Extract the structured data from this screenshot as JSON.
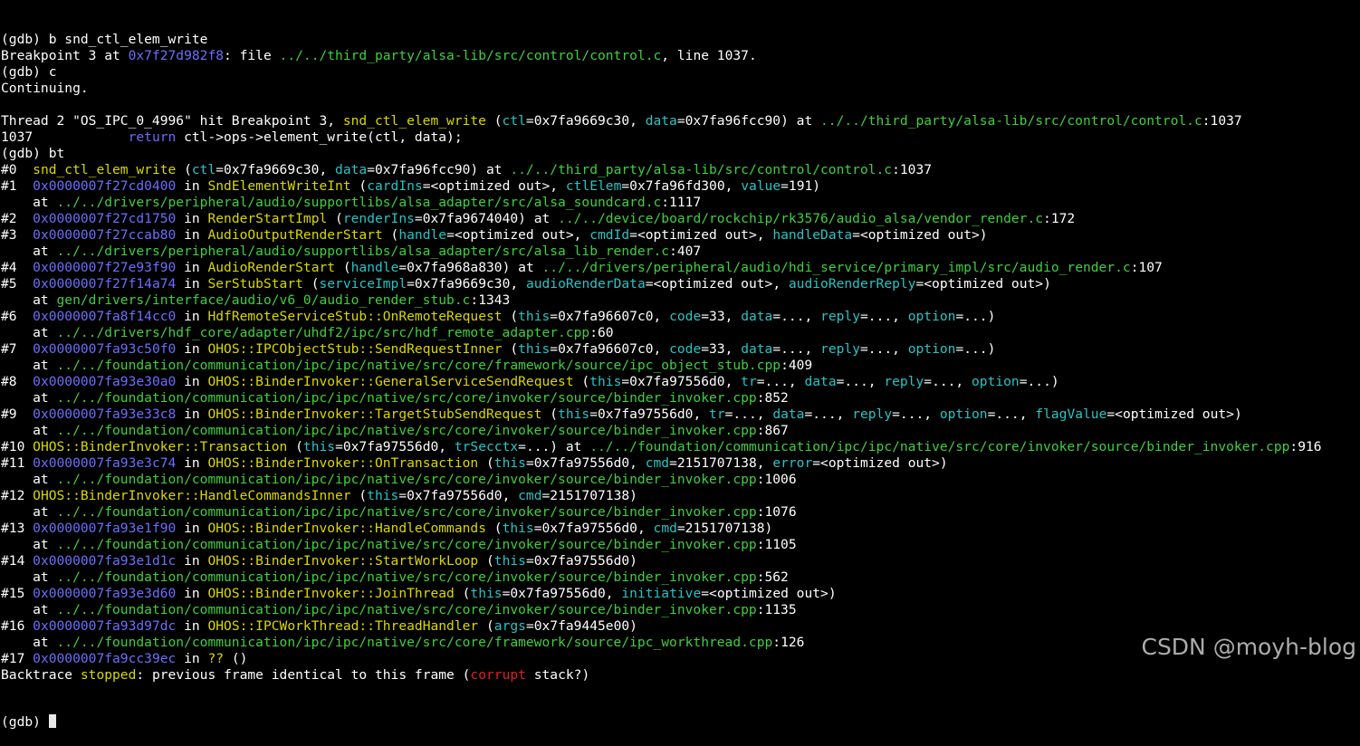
{
  "terminal": {
    "lines": [
      [
        [
          "default",
          "(gdb) b snd_ctl_elem_write"
        ]
      ],
      [
        [
          "default",
          "Breakpoint 3 at "
        ],
        [
          "addr",
          "0x7f27d982f8"
        ],
        [
          "default",
          ": file "
        ],
        [
          "path",
          "../../third_party/alsa-lib/src/control/control.c"
        ],
        [
          "default",
          ", line 1037."
        ]
      ],
      [
        [
          "default",
          "(gdb) c"
        ]
      ],
      [
        [
          "default",
          "Continuing."
        ]
      ],
      [
        [
          "default",
          ""
        ]
      ],
      [
        [
          "default",
          "Thread 2 \"OS_IPC_0_4996\" hit Breakpoint 3, "
        ],
        [
          "func",
          "snd_ctl_elem_write"
        ],
        [
          "default",
          " ("
        ],
        [
          "arg",
          "ctl"
        ],
        [
          "default",
          "=0x7fa9669c30, "
        ],
        [
          "arg",
          "data"
        ],
        [
          "default",
          "=0x7fa96fcc90) at "
        ],
        [
          "path",
          "../../third_party/alsa-lib/src/control/control.c"
        ],
        [
          "default",
          ":1037"
        ]
      ],
      [
        [
          "default",
          "1037            "
        ],
        [
          "kw",
          "return"
        ],
        [
          "default",
          " ctl->ops->element_write(ctl, data);"
        ]
      ],
      [
        [
          "default",
          "(gdb) bt"
        ]
      ],
      [
        [
          "default",
          "#0  "
        ],
        [
          "func",
          "snd_ctl_elem_write"
        ],
        [
          "default",
          " ("
        ],
        [
          "arg",
          "ctl"
        ],
        [
          "default",
          "=0x7fa9669c30, "
        ],
        [
          "arg",
          "data"
        ],
        [
          "default",
          "=0x7fa96fcc90) at "
        ],
        [
          "path",
          "../../third_party/alsa-lib/src/control/control.c"
        ],
        [
          "default",
          ":1037"
        ]
      ],
      [
        [
          "default",
          "#1  "
        ],
        [
          "addr",
          "0x0000007f27cd0400"
        ],
        [
          "default",
          " in "
        ],
        [
          "func",
          "SndElementWriteInt"
        ],
        [
          "default",
          " ("
        ],
        [
          "arg",
          "cardIns"
        ],
        [
          "default",
          "=<optimized out>, "
        ],
        [
          "arg",
          "ctlElem"
        ],
        [
          "default",
          "=0x7fa96fd300, "
        ],
        [
          "arg",
          "value"
        ],
        [
          "default",
          "=191)"
        ]
      ],
      [
        [
          "default",
          "    at "
        ],
        [
          "path",
          "../../drivers/peripheral/audio/supportlibs/alsa_adapter/src/alsa_soundcard.c"
        ],
        [
          "default",
          ":1117"
        ]
      ],
      [
        [
          "default",
          "#2  "
        ],
        [
          "addr",
          "0x0000007f27cd1750"
        ],
        [
          "default",
          " in "
        ],
        [
          "func",
          "RenderStartImpl"
        ],
        [
          "default",
          " ("
        ],
        [
          "arg",
          "renderIns"
        ],
        [
          "default",
          "=0x7fa9674040) at "
        ],
        [
          "path",
          "../../device/board/rockchip/rk3576/audio_alsa/vendor_render.c"
        ],
        [
          "default",
          ":172"
        ]
      ],
      [
        [
          "default",
          "#3  "
        ],
        [
          "addr",
          "0x0000007f27ccab80"
        ],
        [
          "default",
          " in "
        ],
        [
          "func",
          "AudioOutputRenderStart"
        ],
        [
          "default",
          " ("
        ],
        [
          "arg",
          "handle"
        ],
        [
          "default",
          "=<optimized out>, "
        ],
        [
          "arg",
          "cmdId"
        ],
        [
          "default",
          "=<optimized out>, "
        ],
        [
          "arg",
          "handleData"
        ],
        [
          "default",
          "=<optimized out>)"
        ]
      ],
      [
        [
          "default",
          "    at "
        ],
        [
          "path",
          "../../drivers/peripheral/audio/supportlibs/alsa_adapter/src/alsa_lib_render.c"
        ],
        [
          "default",
          ":407"
        ]
      ],
      [
        [
          "default",
          "#4  "
        ],
        [
          "addr",
          "0x0000007f27e93f90"
        ],
        [
          "default",
          " in "
        ],
        [
          "func",
          "AudioRenderStart"
        ],
        [
          "default",
          " ("
        ],
        [
          "arg",
          "handle"
        ],
        [
          "default",
          "=0x7fa968a830) at "
        ],
        [
          "path",
          "../../drivers/peripheral/audio/hdi_service/primary_impl/src/audio_render.c"
        ],
        [
          "default",
          ":107"
        ]
      ],
      [
        [
          "default",
          "#5  "
        ],
        [
          "addr",
          "0x0000007f27f14a74"
        ],
        [
          "default",
          " in "
        ],
        [
          "func",
          "SerStubStart"
        ],
        [
          "default",
          " ("
        ],
        [
          "arg",
          "serviceImpl"
        ],
        [
          "default",
          "=0x7fa9669c30, "
        ],
        [
          "arg",
          "audioRenderData"
        ],
        [
          "default",
          "=<optimized out>, "
        ],
        [
          "arg",
          "audioRenderReply"
        ],
        [
          "default",
          "=<optimized out>)"
        ]
      ],
      [
        [
          "default",
          "    at "
        ],
        [
          "path",
          "gen/drivers/interface/audio/v6_0/audio_render_stub.c"
        ],
        [
          "default",
          ":1343"
        ]
      ],
      [
        [
          "default",
          "#6  "
        ],
        [
          "addr",
          "0x0000007fa8f14cc0"
        ],
        [
          "default",
          " in "
        ],
        [
          "func",
          "HdfRemoteServiceStub::OnRemoteRequest"
        ],
        [
          "default",
          " ("
        ],
        [
          "arg",
          "this"
        ],
        [
          "default",
          "=0x7fa96607c0, "
        ],
        [
          "arg",
          "code"
        ],
        [
          "default",
          "=33, "
        ],
        [
          "arg",
          "data"
        ],
        [
          "default",
          "=..., "
        ],
        [
          "arg",
          "reply"
        ],
        [
          "default",
          "=..., "
        ],
        [
          "arg",
          "option"
        ],
        [
          "default",
          "=...)"
        ]
      ],
      [
        [
          "default",
          "    at "
        ],
        [
          "path",
          "../../drivers/hdf_core/adapter/uhdf2/ipc/src/hdf_remote_adapter.cpp"
        ],
        [
          "default",
          ":60"
        ]
      ],
      [
        [
          "default",
          "#7  "
        ],
        [
          "addr",
          "0x0000007fa93c50f0"
        ],
        [
          "default",
          " in "
        ],
        [
          "func",
          "OHOS::IPCObjectStub::SendRequestInner"
        ],
        [
          "default",
          " ("
        ],
        [
          "arg",
          "this"
        ],
        [
          "default",
          "=0x7fa96607c0, "
        ],
        [
          "arg",
          "code"
        ],
        [
          "default",
          "=33, "
        ],
        [
          "arg",
          "data"
        ],
        [
          "default",
          "=..., "
        ],
        [
          "arg",
          "reply"
        ],
        [
          "default",
          "=..., "
        ],
        [
          "arg",
          "option"
        ],
        [
          "default",
          "=...)"
        ]
      ],
      [
        [
          "default",
          "    at "
        ],
        [
          "path",
          "../../foundation/communication/ipc/ipc/native/src/core/framework/source/ipc_object_stub.cpp"
        ],
        [
          "default",
          ":409"
        ]
      ],
      [
        [
          "default",
          "#8  "
        ],
        [
          "addr",
          "0x0000007fa93e30a0"
        ],
        [
          "default",
          " in "
        ],
        [
          "func",
          "OHOS::BinderInvoker::GeneralServiceSendRequest"
        ],
        [
          "default",
          " ("
        ],
        [
          "arg",
          "this"
        ],
        [
          "default",
          "=0x7fa97556d0, "
        ],
        [
          "arg",
          "tr"
        ],
        [
          "default",
          "=..., "
        ],
        [
          "arg",
          "data"
        ],
        [
          "default",
          "=..., "
        ],
        [
          "arg",
          "reply"
        ],
        [
          "default",
          "=..., "
        ],
        [
          "arg",
          "option"
        ],
        [
          "default",
          "=...)"
        ]
      ],
      [
        [
          "default",
          "    at "
        ],
        [
          "path",
          "../../foundation/communication/ipc/ipc/native/src/core/invoker/source/binder_invoker.cpp"
        ],
        [
          "default",
          ":852"
        ]
      ],
      [
        [
          "default",
          "#9  "
        ],
        [
          "addr",
          "0x0000007fa93e33c8"
        ],
        [
          "default",
          " in "
        ],
        [
          "func",
          "OHOS::BinderInvoker::TargetStubSendRequest"
        ],
        [
          "default",
          " ("
        ],
        [
          "arg",
          "this"
        ],
        [
          "default",
          "=0x7fa97556d0, "
        ],
        [
          "arg",
          "tr"
        ],
        [
          "default",
          "=..., "
        ],
        [
          "arg",
          "data"
        ],
        [
          "default",
          "=..., "
        ],
        [
          "arg",
          "reply"
        ],
        [
          "default",
          "=..., "
        ],
        [
          "arg",
          "option"
        ],
        [
          "default",
          "=..., "
        ],
        [
          "arg",
          "flagValue"
        ],
        [
          "default",
          "=<optimized out>)"
        ]
      ],
      [
        [
          "default",
          "    at "
        ],
        [
          "path",
          "../../foundation/communication/ipc/ipc/native/src/core/invoker/source/binder_invoker.cpp"
        ],
        [
          "default",
          ":867"
        ]
      ],
      [
        [
          "default",
          "#10 "
        ],
        [
          "func",
          "OHOS::BinderInvoker::Transaction"
        ],
        [
          "default",
          " ("
        ],
        [
          "arg",
          "this"
        ],
        [
          "default",
          "=0x7fa97556d0, "
        ],
        [
          "arg",
          "trSecctx"
        ],
        [
          "default",
          "=...) at "
        ],
        [
          "path",
          "../../foundation/communication/ipc/ipc/native/src/core/invoker/source/binder_invoker.cpp"
        ],
        [
          "default",
          ":916"
        ]
      ],
      [
        [
          "default",
          "#11 "
        ],
        [
          "addr",
          "0x0000007fa93e3c74"
        ],
        [
          "default",
          " in "
        ],
        [
          "func",
          "OHOS::BinderInvoker::OnTransaction"
        ],
        [
          "default",
          " ("
        ],
        [
          "arg",
          "this"
        ],
        [
          "default",
          "=0x7fa97556d0, "
        ],
        [
          "arg",
          "cmd"
        ],
        [
          "default",
          "=2151707138, "
        ],
        [
          "arg",
          "error"
        ],
        [
          "default",
          "=<optimized out>)"
        ]
      ],
      [
        [
          "default",
          "    at "
        ],
        [
          "path",
          "../../foundation/communication/ipc/ipc/native/src/core/invoker/source/binder_invoker.cpp"
        ],
        [
          "default",
          ":1006"
        ]
      ],
      [
        [
          "default",
          "#12 "
        ],
        [
          "func",
          "OHOS::BinderInvoker::HandleCommandsInner"
        ],
        [
          "default",
          " ("
        ],
        [
          "arg",
          "this"
        ],
        [
          "default",
          "=0x7fa97556d0, "
        ],
        [
          "arg",
          "cmd"
        ],
        [
          "default",
          "=2151707138)"
        ]
      ],
      [
        [
          "default",
          "    at "
        ],
        [
          "path",
          "../../foundation/communication/ipc/ipc/native/src/core/invoker/source/binder_invoker.cpp"
        ],
        [
          "default",
          ":1076"
        ]
      ],
      [
        [
          "default",
          "#13 "
        ],
        [
          "addr",
          "0x0000007fa93e1f90"
        ],
        [
          "default",
          " in "
        ],
        [
          "func",
          "OHOS::BinderInvoker::HandleCommands"
        ],
        [
          "default",
          " ("
        ],
        [
          "arg",
          "this"
        ],
        [
          "default",
          "=0x7fa97556d0, "
        ],
        [
          "arg",
          "cmd"
        ],
        [
          "default",
          "=2151707138)"
        ]
      ],
      [
        [
          "default",
          "    at "
        ],
        [
          "path",
          "../../foundation/communication/ipc/ipc/native/src/core/invoker/source/binder_invoker.cpp"
        ],
        [
          "default",
          ":1105"
        ]
      ],
      [
        [
          "default",
          "#14 "
        ],
        [
          "addr",
          "0x0000007fa93e1d1c"
        ],
        [
          "default",
          " in "
        ],
        [
          "func",
          "OHOS::BinderInvoker::StartWorkLoop"
        ],
        [
          "default",
          " ("
        ],
        [
          "arg",
          "this"
        ],
        [
          "default",
          "=0x7fa97556d0)"
        ]
      ],
      [
        [
          "default",
          "    at "
        ],
        [
          "path",
          "../../foundation/communication/ipc/ipc/native/src/core/invoker/source/binder_invoker.cpp"
        ],
        [
          "default",
          ":562"
        ]
      ],
      [
        [
          "default",
          "#15 "
        ],
        [
          "addr",
          "0x0000007fa93e3d60"
        ],
        [
          "default",
          " in "
        ],
        [
          "func",
          "OHOS::BinderInvoker::JoinThread"
        ],
        [
          "default",
          " ("
        ],
        [
          "arg",
          "this"
        ],
        [
          "default",
          "=0x7fa97556d0, "
        ],
        [
          "arg",
          "initiative"
        ],
        [
          "default",
          "=<optimized out>)"
        ]
      ],
      [
        [
          "default",
          "    at "
        ],
        [
          "path",
          "../../foundation/communication/ipc/ipc/native/src/core/invoker/source/binder_invoker.cpp"
        ],
        [
          "default",
          ":1135"
        ]
      ],
      [
        [
          "default",
          "#16 "
        ],
        [
          "addr",
          "0x0000007fa93d97dc"
        ],
        [
          "default",
          " in "
        ],
        [
          "func",
          "OHOS::IPCWorkThread::ThreadHandler"
        ],
        [
          "default",
          " ("
        ],
        [
          "arg",
          "args"
        ],
        [
          "default",
          "=0x7fa9445e00)"
        ]
      ],
      [
        [
          "default",
          "    at "
        ],
        [
          "path",
          "../../foundation/communication/ipc/ipc/native/src/core/framework/source/ipc_workthread.cpp"
        ],
        [
          "default",
          ":126"
        ]
      ],
      [
        [
          "default",
          "#17 "
        ],
        [
          "addr",
          "0x0000007fa9cc39ec"
        ],
        [
          "default",
          " in "
        ],
        [
          "func",
          "??"
        ],
        [
          "default",
          " ()"
        ]
      ],
      [
        [
          "default",
          "Backtrace "
        ],
        [
          "func",
          "stopped"
        ],
        [
          "default",
          ": previous frame identical to this frame ("
        ],
        [
          "err",
          "corrupt"
        ],
        [
          "default",
          " stack?)"
        ]
      ]
    ],
    "prompt": "(gdb) "
  },
  "watermark": {
    "text": "CSDN @moyh-blog"
  },
  "colors": {
    "background": "#000000",
    "text": "#ffffff",
    "address": "#6d6dff",
    "path": "#3fcf3f",
    "function": "#d8d800",
    "argument": "#2ac3c3",
    "keyword": "#6a6aff",
    "error": "#dd2222"
  }
}
